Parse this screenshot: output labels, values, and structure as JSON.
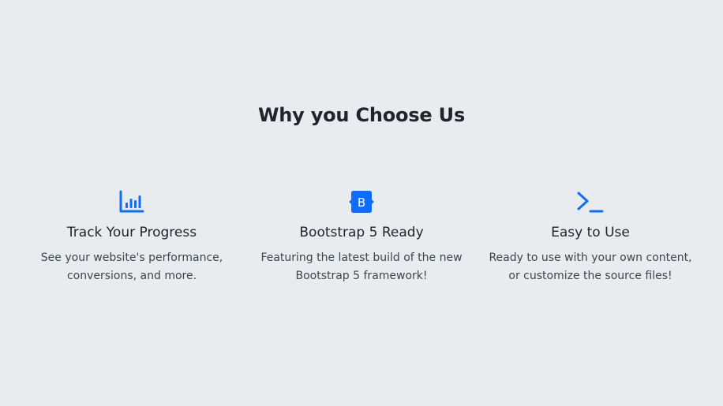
{
  "section": {
    "title": "Why you Choose Us"
  },
  "accent_color": "#0d6efd",
  "features": [
    {
      "icon": "bar-chart-icon",
      "title": "Track Your Progress",
      "description_line1": "See your website's performance,",
      "description_line2": "conversions, and more."
    },
    {
      "icon": "bootstrap-logo-icon",
      "icon_letter": "B",
      "title": "Bootstrap 5 Ready",
      "description_line1": "Featuring the latest build of the new",
      "description_line2": "Bootstrap 5 framework!"
    },
    {
      "icon": "terminal-icon",
      "title": "Easy to Use",
      "description_line1": "Ready to use with your own content,",
      "description_line2": "or customize the source files!"
    }
  ]
}
